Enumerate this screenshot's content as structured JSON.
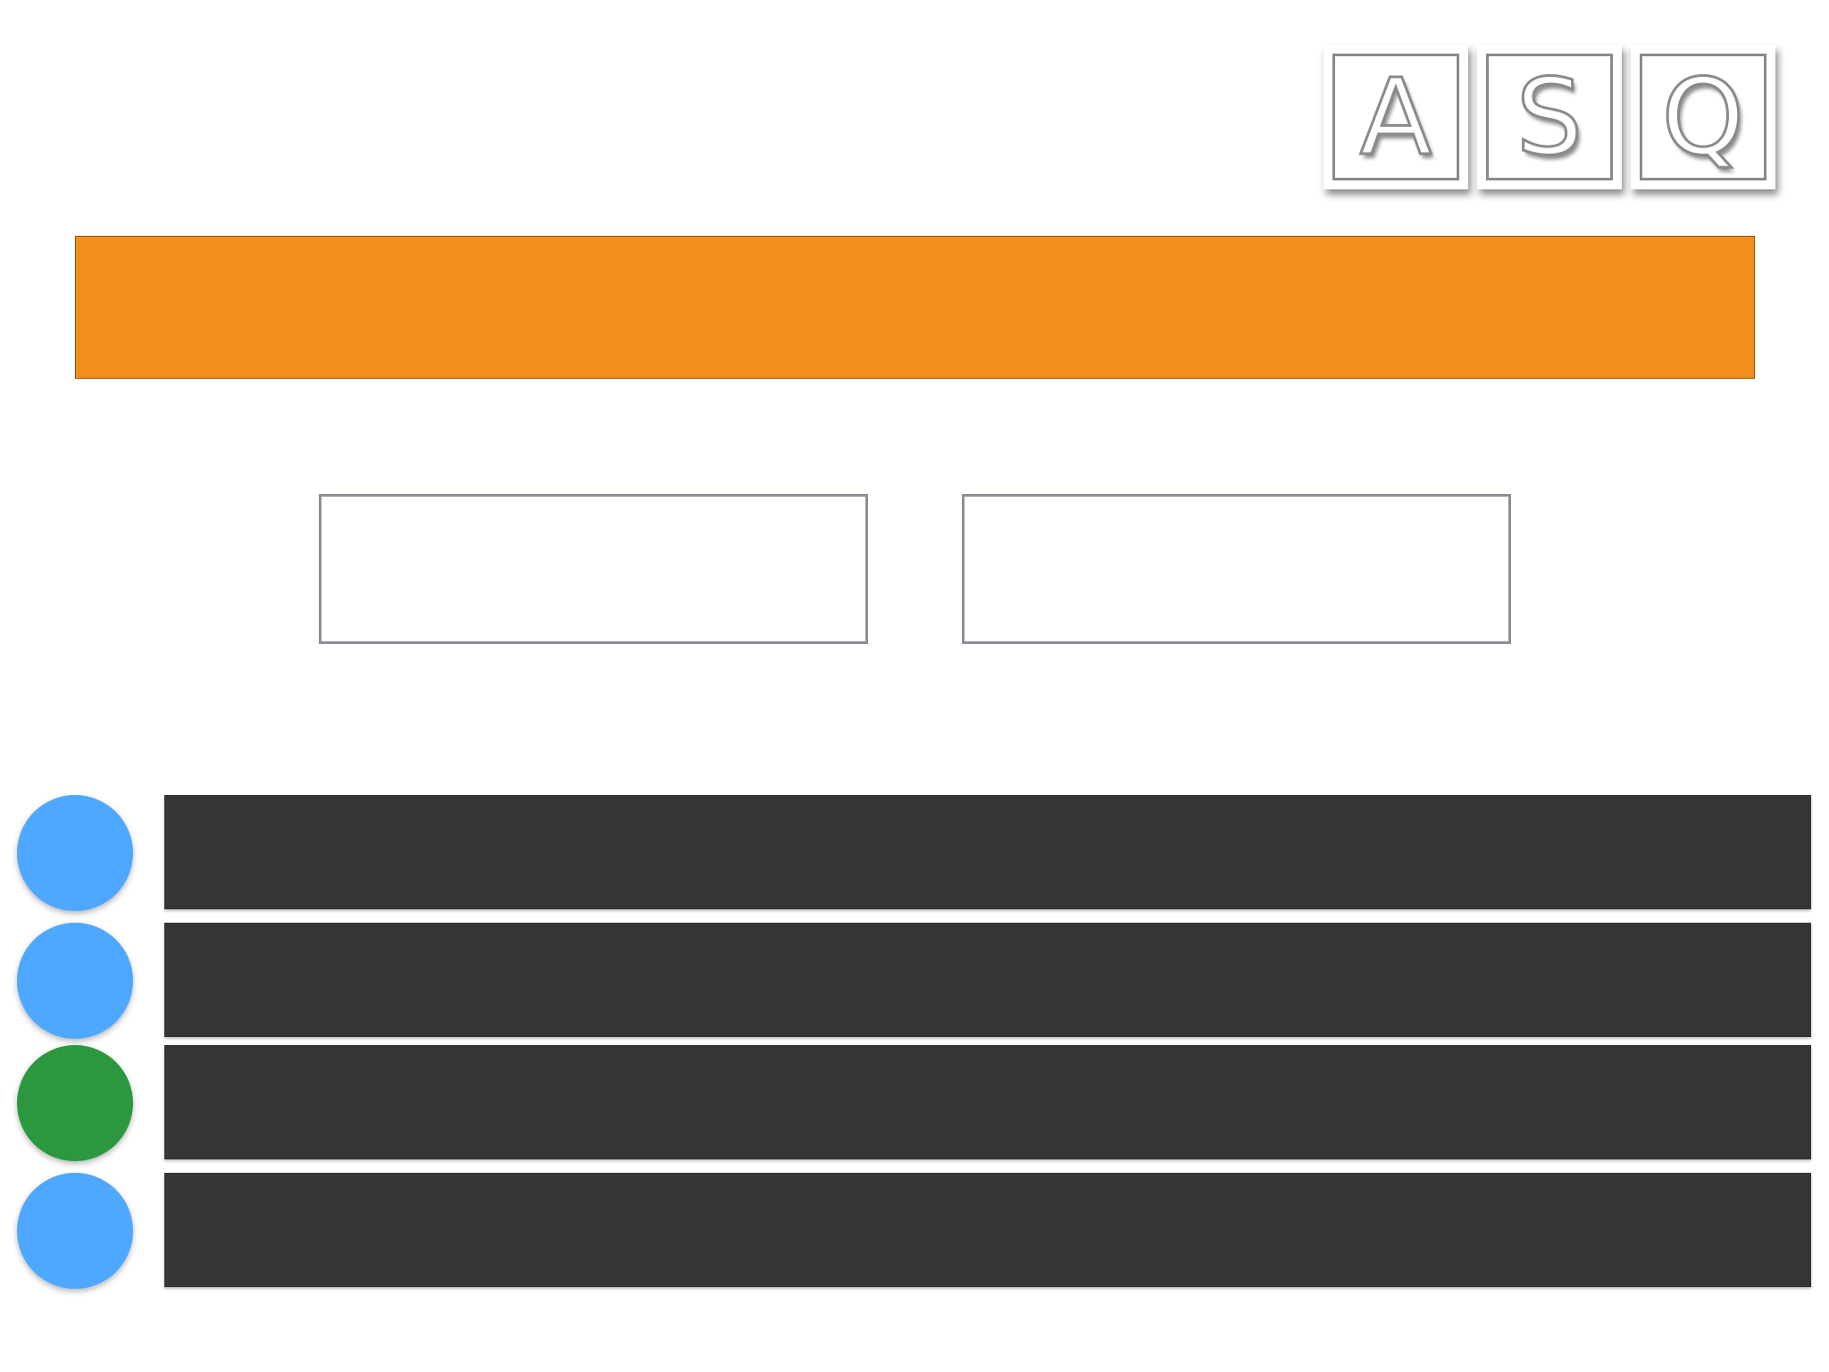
{
  "logo": {
    "letters": [
      "A",
      "S",
      "Q"
    ]
  },
  "question": {
    "text": "",
    "bar_color": "#f28f1c"
  },
  "inputs": [
    {
      "value": ""
    },
    {
      "value": ""
    }
  ],
  "answers": [
    {
      "label": "",
      "indicator_color": "#4fa8ff",
      "state": "default"
    },
    {
      "label": "",
      "indicator_color": "#4fa8ff",
      "state": "default"
    },
    {
      "label": "",
      "indicator_color": "#2b9840",
      "state": "selected"
    },
    {
      "label": "",
      "indicator_color": "#4fa8ff",
      "state": "default"
    }
  ],
  "colors": {
    "answer_bar": "#353535",
    "input_border": "#8f8f98"
  }
}
